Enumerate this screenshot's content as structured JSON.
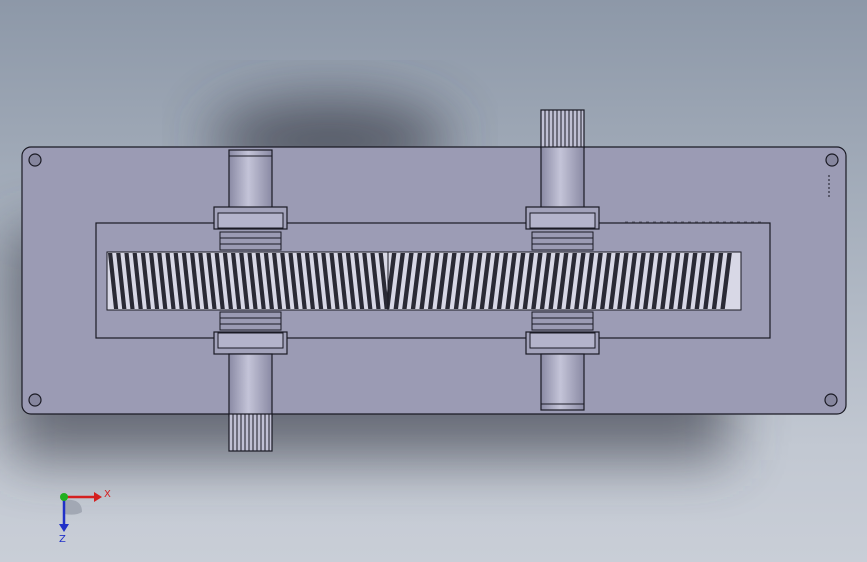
{
  "viewport": {
    "background_top": "#8d98a8",
    "background_bottom": "#c9ced7",
    "shadow_color": "#4a4e58"
  },
  "model": {
    "housing_color": "#9b9bb4",
    "gear_dark": "#2a2a35",
    "gear_light": "#d8d8e6",
    "edge_color": "#1a1a24",
    "shaft_highlight": "#c4c4d8",
    "icons": [
      "mounting-hole-icon",
      "spline-shaft-icon",
      "helical-gear-icon"
    ]
  },
  "triad": {
    "x_label": "X",
    "z_label": "Z",
    "x_color": "#d42020",
    "y_color": "#20b020",
    "z_color": "#2030c8"
  }
}
